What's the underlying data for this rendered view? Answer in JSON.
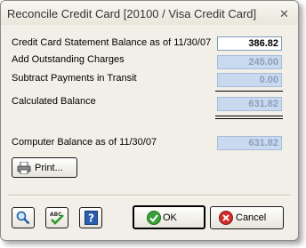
{
  "window": {
    "title": "Reconcile Credit Card [20100 / Visa Credit Card]"
  },
  "rows": {
    "statement": {
      "label": "Credit Card Statement Balance as of 11/30/07",
      "value": "386.82"
    },
    "charges": {
      "label": "Add Outstanding Charges",
      "value": "245.00"
    },
    "payments": {
      "label": "Subtract Payments in Transit",
      "value": "0.00"
    },
    "calculated": {
      "label": "Calculated Balance",
      "value": "631.82"
    },
    "computer": {
      "label": "Computer Balance as of 11/30/07",
      "value": "631.82"
    }
  },
  "buttons": {
    "print": "Print...",
    "ok": "OK",
    "cancel": "Cancel"
  },
  "icons": {
    "find": "magnifier-icon",
    "spell": "abc-check-icon",
    "help": "question-icon",
    "print": "printer-icon",
    "ok": "green-check-icon",
    "cancel": "red-x-icon"
  },
  "colors": {
    "disabled_field_bg": "#c9d9ef",
    "disabled_field_text": "#8c9fba"
  }
}
